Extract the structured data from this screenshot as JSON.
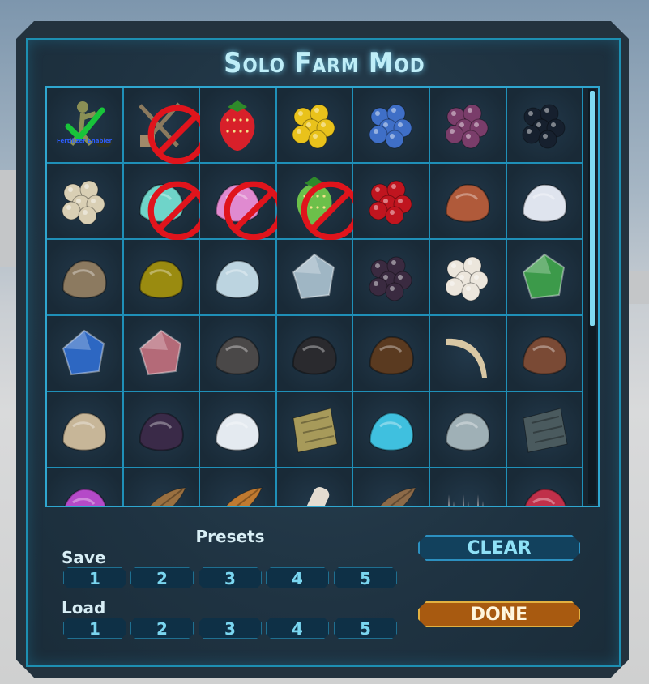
{
  "window": {
    "title": "Solo Farm Mod"
  },
  "grid": {
    "cells": [
      {
        "icon": "fertilizer-enabler-icon",
        "blocked": false,
        "label": "Fertilizer Enabler",
        "checked": true,
        "color": "#8a8f55"
      },
      {
        "icon": "tools-icon",
        "blocked": true,
        "color": "#8b7a5e"
      },
      {
        "icon": "strawberry-icon",
        "blocked": false,
        "color": "#d8202a"
      },
      {
        "icon": "yellow-berries-icon",
        "blocked": false,
        "color": "#e9c21b"
      },
      {
        "icon": "blue-berries-icon",
        "blocked": false,
        "color": "#3f6fc7"
      },
      {
        "icon": "purple-berries-icon",
        "blocked": false,
        "color": "#7a3d6a"
      },
      {
        "icon": "black-berries-icon",
        "blocked": false,
        "color": "#16202e"
      },
      {
        "icon": "white-berries-branch-icon",
        "blocked": false,
        "color": "#d9cfb4"
      },
      {
        "icon": "teal-flower-icon",
        "blocked": true,
        "color": "#6fd4c9"
      },
      {
        "icon": "pink-fruit-icon",
        "blocked": true,
        "color": "#e08ad0"
      },
      {
        "icon": "green-strawberry-icon",
        "blocked": true,
        "color": "#6cc04a"
      },
      {
        "icon": "red-cherries-icon",
        "blocked": false,
        "color": "#c0151f"
      },
      {
        "icon": "mixed-seeds-icon",
        "blocked": false,
        "color": "#b05a3a"
      },
      {
        "icon": "salt-pile-icon",
        "blocked": false,
        "color": "#dfe4ee"
      },
      {
        "icon": "stone-icon",
        "blocked": false,
        "color": "#8c7a60"
      },
      {
        "icon": "sulfur-icon",
        "blocked": false,
        "color": "#9a8b10"
      },
      {
        "icon": "silica-icon",
        "blocked": false,
        "color": "#bcd4e0"
      },
      {
        "icon": "crystal-ore-icon",
        "blocked": false,
        "color": "#9fb6c4"
      },
      {
        "icon": "black-pearls-icon",
        "blocked": false,
        "color": "#3a2a40"
      },
      {
        "icon": "white-pearls-icon",
        "blocked": false,
        "color": "#ece6dc"
      },
      {
        "icon": "green-gem-icon",
        "blocked": false,
        "color": "#3c9a4a"
      },
      {
        "icon": "blue-gem-icon",
        "blocked": false,
        "color": "#2d67c2"
      },
      {
        "icon": "red-gem-icon",
        "blocked": false,
        "color": "#b46a78"
      },
      {
        "icon": "charcoal-pile-icon",
        "blocked": false,
        "color": "#4a4848"
      },
      {
        "icon": "obsidian-icon",
        "blocked": false,
        "color": "#2a2a2e"
      },
      {
        "icon": "chitin-shell-icon",
        "blocked": false,
        "color": "#5a3a20"
      },
      {
        "icon": "tusk-icon",
        "blocked": false,
        "color": "#d8c7a4"
      },
      {
        "icon": "metal-ore-icon",
        "blocked": false,
        "color": "#7a4a35"
      },
      {
        "icon": "clay-icon",
        "blocked": false,
        "color": "#c7b698"
      },
      {
        "icon": "element-dust-icon",
        "blocked": false,
        "color": "#3a2a48"
      },
      {
        "icon": "white-crystal-icon",
        "blocked": false,
        "color": "#e4eaf0"
      },
      {
        "icon": "circuit-plate-icon",
        "blocked": false,
        "color": "#a79a5a"
      },
      {
        "icon": "cyan-crystal-pile-icon",
        "blocked": false,
        "color": "#3fc0df"
      },
      {
        "icon": "silver-flakes-icon",
        "blocked": false,
        "color": "#9fb0b6"
      },
      {
        "icon": "scale-mesh-icon",
        "blocked": false,
        "color": "#4a5a5e"
      },
      {
        "icon": "purple-ore-icon",
        "blocked": false,
        "color": "#b54ac8"
      },
      {
        "icon": "wood-icon",
        "blocked": false,
        "color": "#9a7040"
      },
      {
        "icon": "orange-wood-icon",
        "blocked": false,
        "color": "#c07a30"
      },
      {
        "icon": "white-bone-icon",
        "blocked": false,
        "color": "#e4dcd0"
      },
      {
        "icon": "brown-leaf-icon",
        "blocked": false,
        "color": "#8c6a48"
      },
      {
        "icon": "spikes-icon",
        "blocked": false,
        "color": "#8a8a90"
      },
      {
        "icon": "red-coral-icon",
        "blocked": false,
        "color": "#c0304a"
      }
    ]
  },
  "presets": {
    "title": "Presets",
    "save_label": "Save",
    "load_label": "Load",
    "slots": [
      "1",
      "2",
      "3",
      "4",
      "5"
    ]
  },
  "buttons": {
    "clear": "CLEAR",
    "done": "DONE"
  },
  "colors": {
    "accent": "#2fa6cf",
    "done": "#a85a10",
    "title_glow": "#bfeef8"
  }
}
